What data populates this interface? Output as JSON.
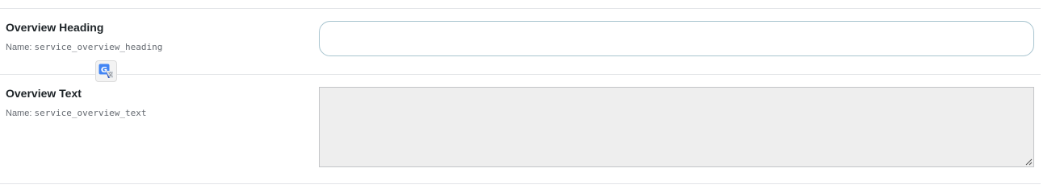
{
  "fields": [
    {
      "label": "Overview Heading",
      "name_prefix": "Name:",
      "name_value": "service_overview_heading",
      "input_value": ""
    },
    {
      "label": "Overview Text",
      "name_prefix": "Name:",
      "name_value": "service_overview_text",
      "input_value": ""
    }
  ],
  "translate_button": {
    "icon": "google-translate-icon",
    "glyph": "G"
  },
  "colors": {
    "input_focus_border": "#a7c4cf",
    "textarea_background": "#eeeeee",
    "translate_icon_blue": "#4285f4"
  }
}
